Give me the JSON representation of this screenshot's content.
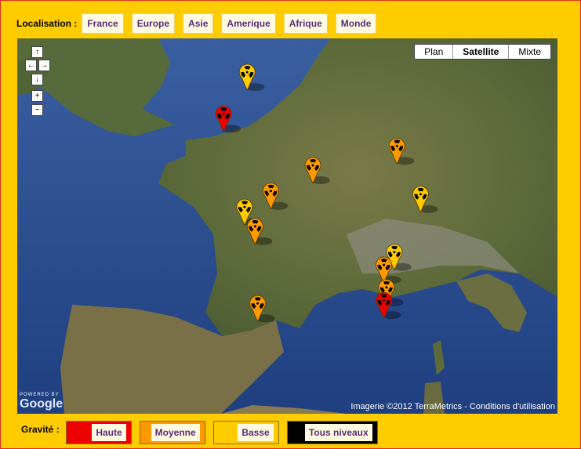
{
  "header": {
    "localisation_label": "Localisation :",
    "nav": [
      "France",
      "Europe",
      "Asie",
      "Amerique",
      "Afrique",
      "Monde"
    ]
  },
  "map": {
    "type_buttons": [
      "Plan",
      "Satellite",
      "Mixte"
    ],
    "active_type": "Satellite",
    "credit": "Imagerie ©2012 TerraMetrics - Conditions d'utilisation",
    "logo_small": "POWERED BY",
    "logo": "Google",
    "controls": {
      "up": "↑",
      "left": "←",
      "right": "→",
      "down": "↓",
      "zoom_in": "+",
      "zoom_out": "−"
    },
    "markers": [
      {
        "level": "basse",
        "lon": -0.5,
        "lat": 50.9
      },
      {
        "level": "haute",
        "lon": -1.4,
        "lat": 49.6
      },
      {
        "level": "moyenne",
        "lon": 2.0,
        "lat": 48.0
      },
      {
        "level": "moyenne",
        "lon": 5.2,
        "lat": 48.6
      },
      {
        "level": "basse",
        "lon": 6.1,
        "lat": 47.1
      },
      {
        "level": "moyenne",
        "lon": 0.4,
        "lat": 47.2
      },
      {
        "level": "basse",
        "lon": -0.6,
        "lat": 46.7
      },
      {
        "level": "moyenne",
        "lon": -0.2,
        "lat": 46.1
      },
      {
        "level": "basse",
        "lon": 5.1,
        "lat": 45.3
      },
      {
        "level": "moyenne",
        "lon": 4.7,
        "lat": 44.9
      },
      {
        "level": "moyenne",
        "lon": 4.8,
        "lat": 44.2
      },
      {
        "level": "haute",
        "lon": 4.7,
        "lat": 43.8
      },
      {
        "level": "moyenne",
        "lon": -0.1,
        "lat": 43.7
      }
    ]
  },
  "colors": {
    "haute": "#ee0000",
    "moyenne": "#ff9900",
    "basse": "#ffcc00",
    "tous": "#000000"
  },
  "legend": {
    "label": "Gravité :",
    "items": [
      {
        "key": "haute",
        "label": "Haute"
      },
      {
        "key": "moyenne",
        "label": "Moyenne"
      },
      {
        "key": "basse",
        "label": "Basse"
      },
      {
        "key": "tous",
        "label": "Tous niveaux"
      }
    ]
  }
}
